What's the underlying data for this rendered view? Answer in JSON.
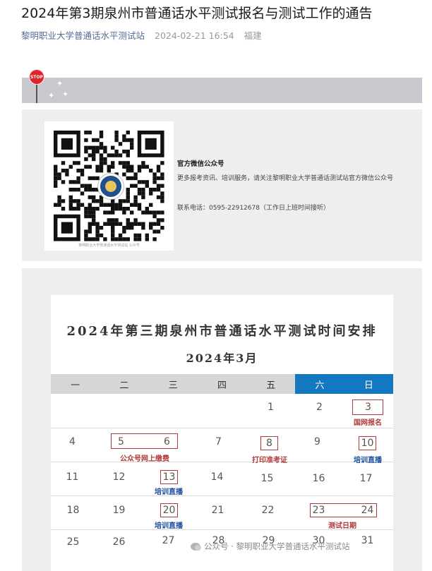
{
  "article": {
    "title": "2024年第3期泉州市普通话水平测试报名与测试工作的通告",
    "account": "黎明职业大学普通话水平测试站",
    "datetime": "2024-02-21 16:54",
    "location": "福建"
  },
  "banner": {
    "stop_text": "STOP"
  },
  "wechat": {
    "title": "官方微信公众号",
    "desc": "更多报考资讯、培训服务，请关注黎明职业大学普通话测试站官方微信公众号",
    "phone": "联系电话：0595-22912678（工作日上班时间接听）",
    "qr_caption": "黎明职业大学普通话水平测试站 公众号"
  },
  "calendar": {
    "title": "2024年第三期泉州市普通话水平测试时间安排",
    "month": "2024年3月",
    "weekdays": [
      "一",
      "二",
      "三",
      "四",
      "五",
      "六",
      "日"
    ],
    "days": [
      "1",
      "2",
      "3",
      "4",
      "5",
      "6",
      "7",
      "8",
      "9",
      "10",
      "11",
      "12",
      "13",
      "14",
      "15",
      "16",
      "17",
      "18",
      "19",
      "20",
      "21",
      "22",
      "23",
      "24",
      "25",
      "26",
      "27",
      "28",
      "29",
      "30",
      "31"
    ],
    "notes": {
      "guowang": "国网报名",
      "jiaofei": "公众号网上缴费",
      "dayin": "打印准考证",
      "peixun": "培训直播",
      "ceshi": "测试日期"
    },
    "colors": {
      "weekend_header": "#1478c0",
      "red": "#b03a3a",
      "blue": "#1a4d9a"
    }
  },
  "watermark": "公众号 · 黎明职业大学普通话水平测试站"
}
